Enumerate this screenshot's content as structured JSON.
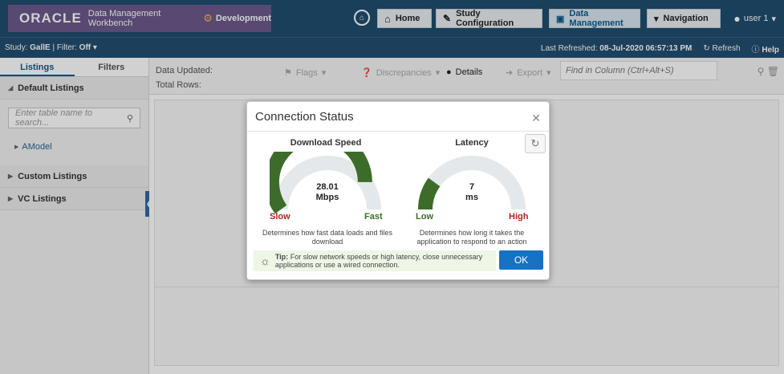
{
  "header": {
    "brand": "ORACLE",
    "product": "Data Management Workbench",
    "environment": "Development",
    "nav": [
      {
        "label": "Home",
        "icon": "home-icon"
      },
      {
        "label": "Study Configuration",
        "icon": "tools-icon"
      },
      {
        "label": "Data Management",
        "icon": "data-icon"
      },
      {
        "label": "Navigation",
        "icon": "navigation-icon"
      }
    ],
    "user": "user 1"
  },
  "subbar": {
    "study_label": "Study:",
    "study_value": "GallE",
    "filter_label": "Filter:",
    "filter_value": "Off",
    "last_refreshed_label": "Last Refreshed:",
    "last_refreshed_value": "08-Jul-2020 06:57:13 PM",
    "refresh": "Refresh",
    "help": "Help"
  },
  "left": {
    "tabs": [
      "Listings",
      "Filters"
    ],
    "default_listings": "Default Listings",
    "search_placeholder": "Enter table name to search...",
    "tree_item": "AModel",
    "custom_listings": "Custom Listings",
    "vc_listings": "VC Listings"
  },
  "main": {
    "data_updated": "Data Updated:",
    "total_rows": "Total Rows:",
    "toolbar": {
      "flags": "Flags",
      "discrepancies": "Discrepancies",
      "details": "Details",
      "export": "Export"
    },
    "find_placeholder": "Find in Column (Ctrl+Alt+S)"
  },
  "dialog": {
    "title": "Connection Status",
    "download": {
      "title": "Download Speed",
      "value": "28.01",
      "unit": "Mbps",
      "low": "Slow",
      "high": "Fast",
      "fraction": 0.8,
      "description_1": "Determines how fast data loads and files",
      "description_2": "download",
      "color": "#3d6b2a"
    },
    "latency": {
      "title": "Latency",
      "value": "7",
      "unit": "ms",
      "low": "Low",
      "high": "High",
      "fraction": 0.2,
      "description_1": "Determines how long it takes the",
      "description_2": "application to respond to an action",
      "color": "#3d6b2a"
    },
    "tip_label": "Tip:",
    "tip_text_1": "For slow network speeds or high latency, close unnecessary",
    "tip_text_2": "applications or use a wired connection.",
    "ok": "OK"
  },
  "colors": {
    "topbar": "#1f4d6e",
    "brand_bg": "#6b5a8c",
    "gauge_fill": "#3d6b2a",
    "gauge_track": "#e4e8eb",
    "slow_red": "#b22222",
    "ok_blue": "#1572c4"
  }
}
